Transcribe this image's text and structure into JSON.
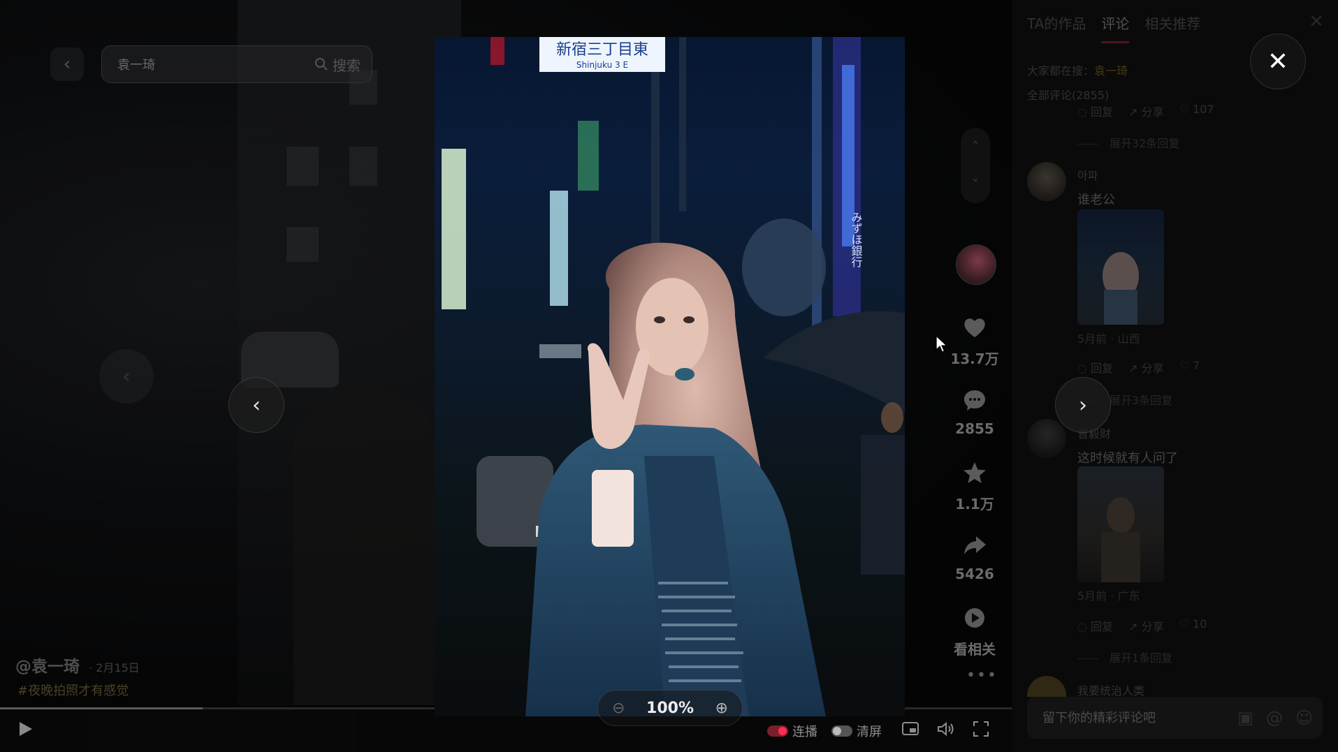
{
  "search": {
    "value": "袁一琦",
    "button_label": "搜索"
  },
  "post": {
    "author": "@袁一琦",
    "date": "· 2月15日",
    "hashtag": "#夜晚拍照才有感觉"
  },
  "player": {
    "progress": 0.2,
    "autoplay_label": "连播",
    "clear_label": "清屏"
  },
  "actions": {
    "likes": "13.7万",
    "comments": "2855",
    "favorites": "1.1万",
    "shares": "5426",
    "related_label": "看相关"
  },
  "panel": {
    "tabs": [
      {
        "label": "TA的作品"
      },
      {
        "label": "评论",
        "active": true
      },
      {
        "label": "相关推荐"
      }
    ],
    "trending_prefix": "大家都在搜：",
    "trending_keyword": "袁一琦",
    "comment_count_label": "全部评论(2855)",
    "top_actions": {
      "reply": "回复",
      "share": "分享",
      "likes": "107"
    },
    "top_expand": "展开32条回复",
    "comments": [
      {
        "user": "아파",
        "text": "谁老公",
        "meta": "5月前 · 山西",
        "reply": "回复",
        "share": "分享",
        "likes": "7",
        "expand": "展开3条回复"
      },
      {
        "user": "曾毅财",
        "text": "这时候就有人问了",
        "meta": "5月前 · 广东",
        "reply": "回复",
        "share": "分享",
        "likes": "10",
        "expand": "展开1条回复"
      },
      {
        "user": "我要统治人类"
      }
    ],
    "input_placeholder": "留下你的精彩评论吧"
  },
  "viewer": {
    "zoom": "100%",
    "street_sign_top": "新宿三丁目東",
    "street_sign_bottom": "Shinjuku 3 E",
    "tower_text": "みずほ銀行"
  },
  "colors": {
    "accent": "#fe2c55",
    "keyword": "#e6b422",
    "background": "#0b0b0c"
  },
  "icons": [
    "back-arrow-icon",
    "search-icon",
    "heart-icon",
    "comment-icon",
    "star-icon",
    "share-icon",
    "play-icon",
    "close-icon",
    "zoom-in-icon",
    "zoom-out-icon",
    "chevron-left-icon",
    "chevron-right-icon"
  ]
}
